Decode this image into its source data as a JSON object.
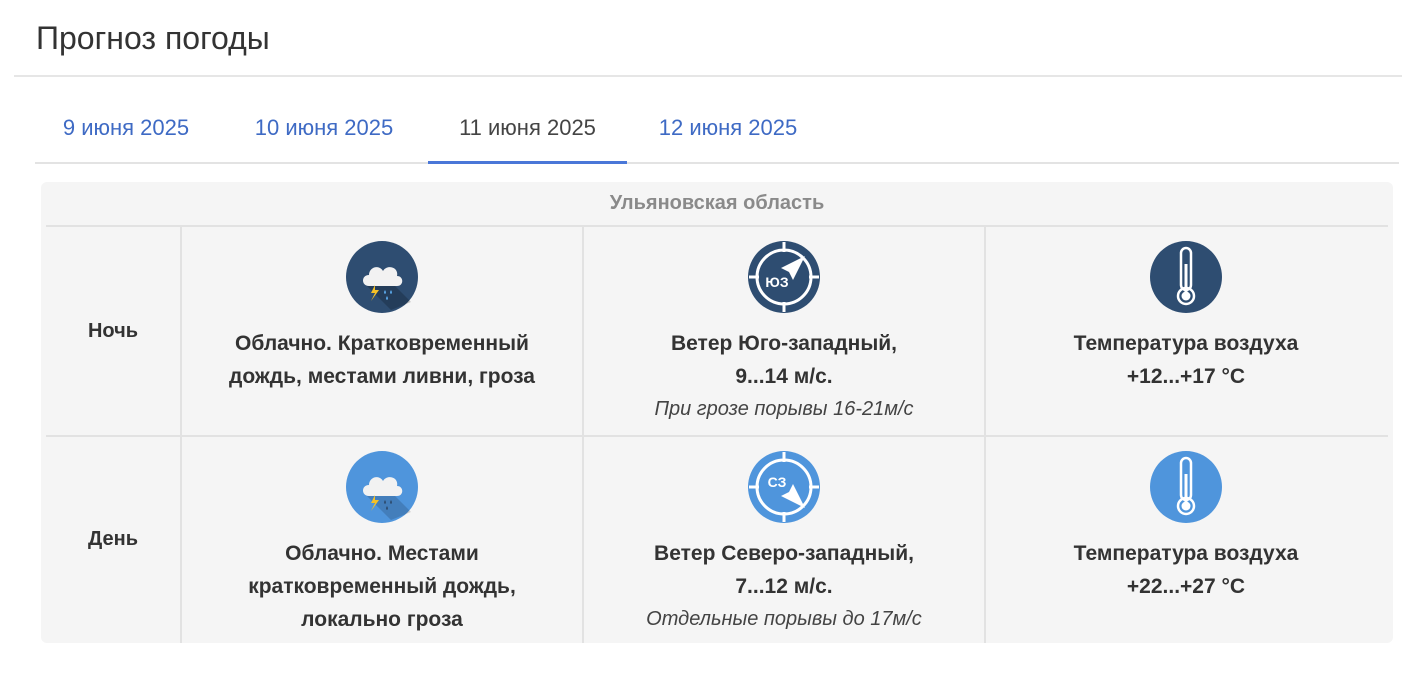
{
  "page": {
    "title": "Прогноз погоды"
  },
  "tabs": [
    {
      "label": "9 июня 2025",
      "active": false
    },
    {
      "label": "10 июня 2025",
      "active": false
    },
    {
      "label": "11 июня 2025",
      "active": true
    },
    {
      "label": "12 июня 2025",
      "active": false
    }
  ],
  "forecast": {
    "region": "Ульяновская область",
    "rows": [
      {
        "period": "Ночь",
        "weather": {
          "icon": "cloud-rain-thunder-icon",
          "line1": "Облачно. Кратковременный",
          "line2": "дождь, местами ливни, гроза"
        },
        "wind": {
          "icon": "wind-direction-sw-icon",
          "icon_label": "ЮЗ",
          "line1": "Ветер Юго-западный,",
          "line2": "9...14 м/с.",
          "note": "При грозе порывы 16-21м/с"
        },
        "temperature": {
          "icon": "thermometer-icon",
          "line1": "Температура воздуха",
          "line2": "+12...+17 °С"
        }
      },
      {
        "period": "День",
        "weather": {
          "icon": "cloud-rain-thunder-icon",
          "line1": "Облачно. Местами",
          "line2": "кратковременный дождь,",
          "line3": "локально гроза"
        },
        "wind": {
          "icon": "wind-direction-nw-icon",
          "icon_label": "СЗ",
          "line1": "Ветер Северо-западный,",
          "line2": "7...12 м/с.",
          "note": "Отдельные порывы до 17м/с"
        },
        "temperature": {
          "icon": "thermometer-icon",
          "line1": "Температура воздуха",
          "line2": "+22...+27 °С"
        }
      }
    ]
  },
  "colors": {
    "link": "#3e6ac4",
    "tab_underline": "#4a77d8",
    "night_icon": "#2e4d71",
    "day_icon": "#4f95dc",
    "card_bg": "#f5f5f5"
  }
}
